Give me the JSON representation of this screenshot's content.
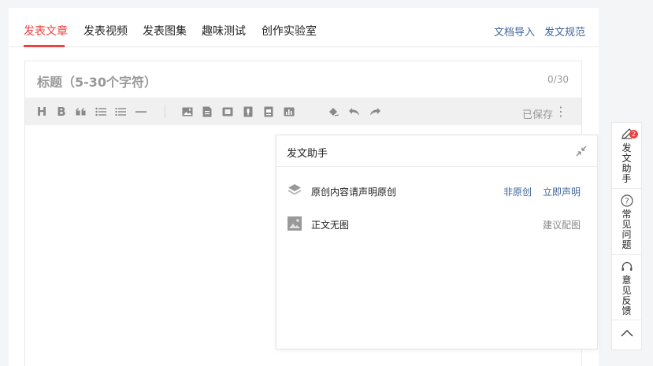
{
  "tabs": [
    "发表文章",
    "发表视频",
    "发表图集",
    "趣味测试",
    "创作实验室"
  ],
  "top_links": {
    "import": "文档导入",
    "rules": "发文规范"
  },
  "editor": {
    "title_placeholder": "标题（5-30个字符）",
    "title_count": "0/30",
    "saved": "已保存"
  },
  "toolbar_icons": [
    "heading-icon",
    "bold-icon",
    "quote-icon",
    "bullet-list-icon",
    "numbered-list-icon",
    "divider-icon",
    "image-icon",
    "document-icon",
    "video-icon",
    "audio-icon",
    "card-icon",
    "chart-icon",
    "clear-format-icon",
    "undo-icon",
    "redo-icon",
    "more-icon"
  ],
  "assistant": {
    "title": "发文助手",
    "items": [
      {
        "label": "原创内容请声明原创",
        "actions": [
          "非原创",
          "立即声明"
        ]
      },
      {
        "label": "正文无图",
        "actions": [
          "建议配图"
        ]
      }
    ]
  },
  "rail": {
    "assistant_label": "发文助手",
    "assistant_badge": "2",
    "faq_label": "常见问题",
    "feedback_label": "意见反馈"
  },
  "colors": {
    "accent": "#f04142",
    "link": "#406599",
    "toolbar_bg": "#f0f0f0"
  }
}
